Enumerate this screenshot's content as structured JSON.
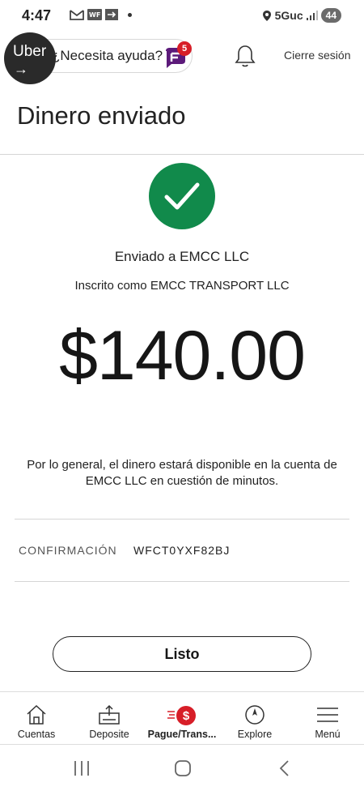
{
  "status_bar": {
    "time": "4:47",
    "badge_text": "WF",
    "network": "5Guc",
    "battery": "44"
  },
  "top_bar": {
    "help_label": "¿Necesita ayuda?",
    "chat_badge_count": "5",
    "uber_label": "Uber",
    "uber_arrow": "→",
    "logout_label": "Cierre sesión"
  },
  "page": {
    "title": "Dinero enviado",
    "sent_to": "Enviado a EMCC LLC",
    "enrolled_as": "Inscrito como EMCC TRANSPORT LLC",
    "amount": "$140.00",
    "availability_note": "Por lo general, el dinero estará disponible en la cuenta de EMCC LLC en cuestión de minutos.",
    "confirmation_label": "CONFIRMACIÓN",
    "confirmation_value": "WFCT0YXF82BJ",
    "done_label": "Listo"
  },
  "bottom_nav": {
    "items": [
      {
        "label": "Cuentas",
        "icon": "home-icon"
      },
      {
        "label": "Deposite",
        "icon": "deposit-icon"
      },
      {
        "label": "Pague/Trans...",
        "icon": "dollar-icon",
        "active": true
      },
      {
        "label": "Explore",
        "icon": "compass-icon"
      },
      {
        "label": "Menú",
        "icon": "hamburger-icon"
      }
    ]
  },
  "colors": {
    "success_green": "#118a4b",
    "brand_red": "#d71e28",
    "chat_purple": "#5c1a7a"
  }
}
